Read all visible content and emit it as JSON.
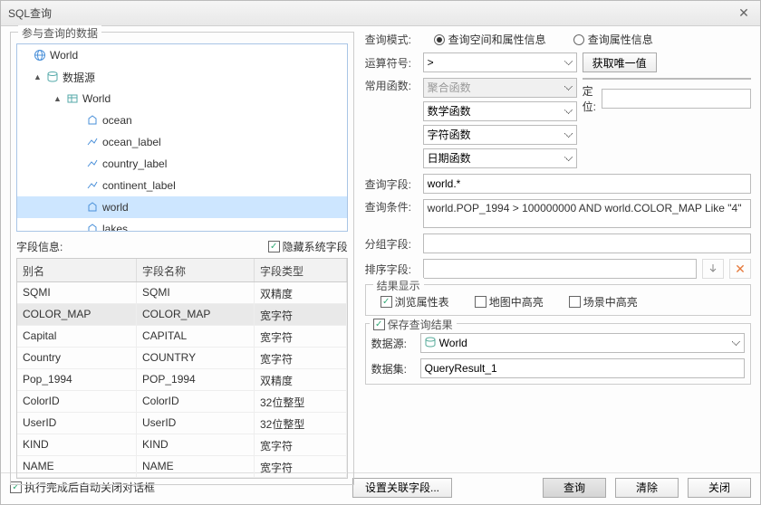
{
  "window": {
    "title": "SQL查询"
  },
  "left": {
    "participate_legend": "参与查询的数据",
    "tree": [
      {
        "label": "World",
        "icon": "globe",
        "level": 0,
        "toggle": ""
      },
      {
        "label": "数据源",
        "icon": "datasource",
        "level": 1,
        "toggle": "▲"
      },
      {
        "label": "World",
        "icon": "dataset",
        "level": 2,
        "toggle": "▲"
      },
      {
        "label": "ocean",
        "icon": "region",
        "level": 3,
        "toggle": ""
      },
      {
        "label": "ocean_label",
        "icon": "line",
        "level": 3,
        "toggle": ""
      },
      {
        "label": "country_label",
        "icon": "line",
        "level": 3,
        "toggle": ""
      },
      {
        "label": "continent_label",
        "icon": "line",
        "level": 3,
        "toggle": ""
      },
      {
        "label": "world",
        "icon": "region",
        "level": 3,
        "toggle": "",
        "selected": true
      },
      {
        "label": "lakes",
        "icon": "region",
        "level": 3,
        "toggle": ""
      }
    ],
    "field_info_label": "字段信息:",
    "hide_sys_fields_label": "隐藏系统字段",
    "hide_sys_fields_checked": true,
    "table_headers": {
      "alias": "别名",
      "name": "字段名称",
      "type": "字段类型"
    },
    "table_rows": [
      {
        "alias": "SQMI",
        "name": "SQMI",
        "type": "双精度"
      },
      {
        "alias": "COLOR_MAP",
        "name": "COLOR_MAP",
        "type": "宽字符",
        "selected": true
      },
      {
        "alias": "Capital",
        "name": "CAPITAL",
        "type": "宽字符"
      },
      {
        "alias": "Country",
        "name": "COUNTRY",
        "type": "宽字符"
      },
      {
        "alias": "Pop_1994",
        "name": "POP_1994",
        "type": "双精度"
      },
      {
        "alias": "ColorID",
        "name": "ColorID",
        "type": "32位整型"
      },
      {
        "alias": "UserID",
        "name": "UserID",
        "type": "32位整型"
      },
      {
        "alias": "KIND",
        "name": "KIND",
        "type": "宽字符"
      },
      {
        "alias": "NAME",
        "name": "NAME",
        "type": "宽字符"
      }
    ]
  },
  "right": {
    "query_mode_label": "查询模式:",
    "radio1": "查询空间和属性信息",
    "radio2": "查询属性信息",
    "operator_label": "运算符号:",
    "operator_value": ">",
    "get_unique_btn": "获取唯一值",
    "common_func_label": "常用函数:",
    "aggregate_placeholder": "聚合函数",
    "math_label": "数学函数",
    "string_label": "字符函数",
    "date_label": "日期函数",
    "locate_label": "定位:",
    "query_field_label": "查询字段:",
    "query_field_value": "world.*",
    "query_cond_label": "查询条件:",
    "query_cond_value": "world.POP_1994 > 100000000 AND world.COLOR_MAP Like \"4\"",
    "group_field_label": "分组字段:",
    "sort_field_label": "排序字段:",
    "result_display_legend": "结果显示",
    "browse_attr_label": "浏览属性表",
    "browse_attr_checked": true,
    "highlight_map_label": "地图中高亮",
    "highlight_scene_label": "场景中高亮",
    "save_result_label": "保存查询结果",
    "save_result_checked": true,
    "datasource_label": "数据源:",
    "datasource_value": "World",
    "dataset_label": "数据集:",
    "dataset_value": "QueryResult_1"
  },
  "footer": {
    "auto_close_label": "执行完成后自动关闭对话框",
    "auto_close_checked": true,
    "set_relate_btn": "设置关联字段...",
    "query_btn": "查询",
    "clear_btn": "清除",
    "close_btn": "关闭"
  }
}
